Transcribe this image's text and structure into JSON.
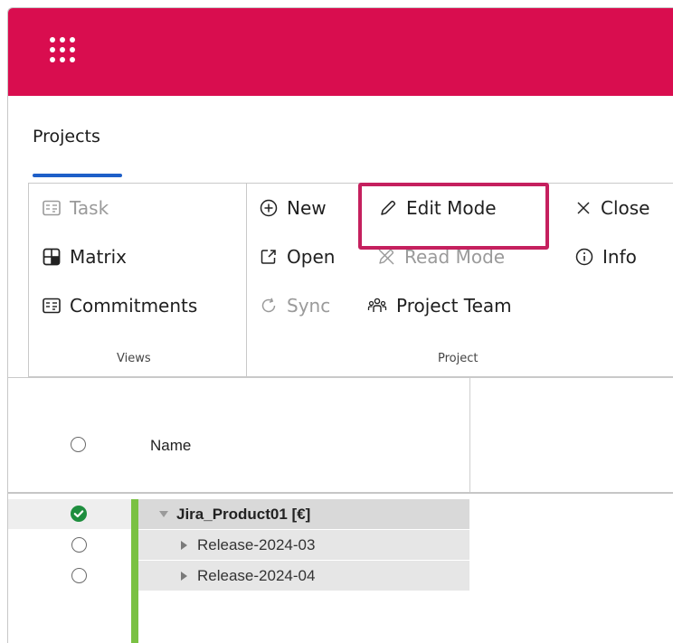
{
  "tabs": {
    "active": "Projects"
  },
  "ribbon": {
    "views": {
      "label": "Views",
      "items": [
        {
          "label": "Task",
          "icon": "task-board-icon",
          "enabled": false
        },
        {
          "label": "Matrix",
          "icon": "matrix-icon",
          "enabled": true
        },
        {
          "label": "Commitments",
          "icon": "commitments-icon",
          "enabled": true
        }
      ]
    },
    "project": {
      "label": "Project",
      "new": "New",
      "edit_mode": "Edit Mode",
      "close": "Close",
      "open": "Open",
      "read_mode": "Read Mode",
      "info": "Info",
      "sync": "Sync",
      "project_team": "Project Team"
    }
  },
  "grid": {
    "header": {
      "name": "Name"
    },
    "rows": [
      {
        "name": "Jira_Product01 [€]",
        "expanded": true,
        "selected": true
      },
      {
        "name": "Release-2024-03",
        "expanded": false,
        "selected": false
      },
      {
        "name": "Release-2024-04",
        "expanded": false,
        "selected": false
      }
    ]
  },
  "colors": {
    "topbar": "#d90d4f",
    "highlight": "#c5205e",
    "tab_underline": "#1e5fc8",
    "status_bar": "#7ac143",
    "selected_check": "#1e8e3e"
  }
}
